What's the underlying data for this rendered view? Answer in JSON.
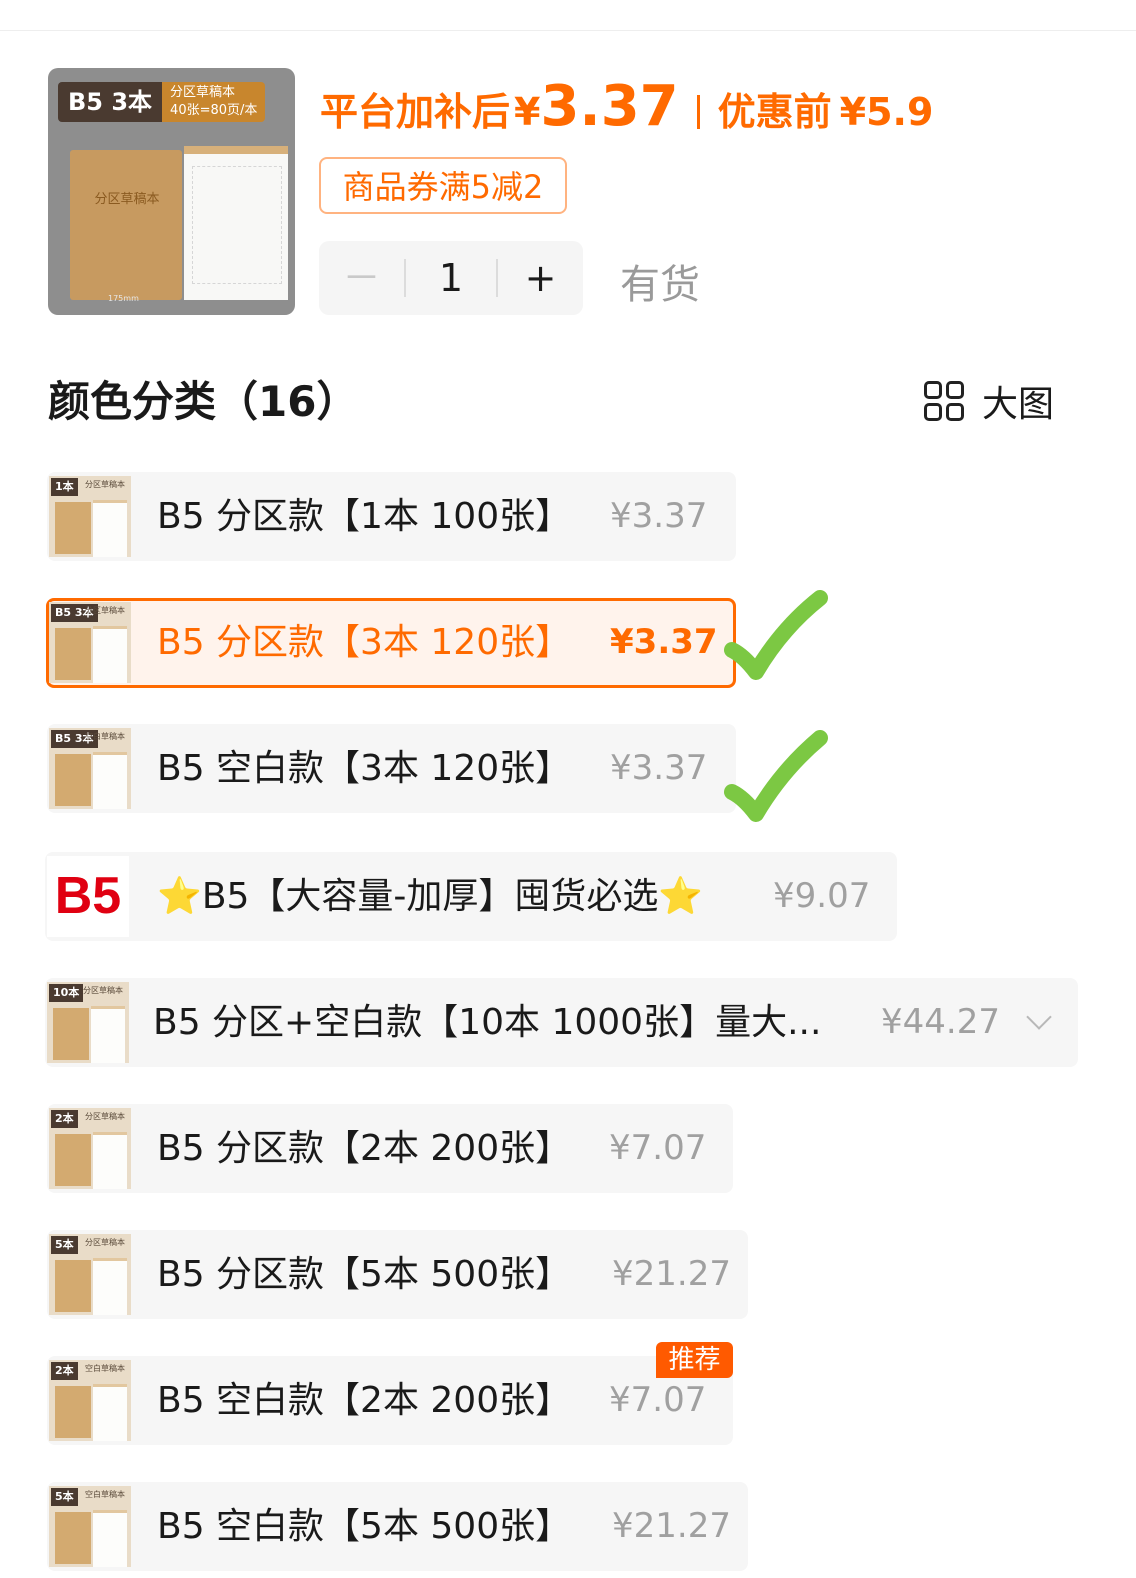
{
  "product": {
    "thumb_tag_main": "B5 3本",
    "thumb_tag_sub1": "分区草稿本",
    "thumb_tag_sub2": "40张=80页/本",
    "thumb_book_title": "分区草稿本",
    "thumb_dim": "175mm",
    "price_label": "平台加补后",
    "currency": "¥",
    "price_value": "3.37",
    "original_label": "优惠前",
    "original_price": "¥5.9",
    "coupon": "商品券满5减2",
    "quantity": "1",
    "minus": "－",
    "plus": "+",
    "stock": "有货"
  },
  "section": {
    "title": "颜色分类（16）",
    "view_label": "大图"
  },
  "options": [
    {
      "name": "B5 分区款【1本 100张】",
      "price": "¥3.37",
      "thumb_tag": "1本",
      "thumb_sub": "分区草稿本"
    },
    {
      "name": "B5 分区款【3本 120张】",
      "price": "¥3.37",
      "thumb_tag": "B5 3本",
      "thumb_sub": "分区草稿本",
      "selected": true
    },
    {
      "name": "B5 空白款【3本 120张】",
      "price": "¥3.37",
      "thumb_tag": "B5 3本",
      "thumb_sub": "空白草稿本"
    },
    {
      "name_prefix": "⭐",
      "name": "B5【大容量-加厚】囤货必选",
      "name_suffix": "⭐",
      "price": "¥9.07",
      "thumb_text": "B5"
    },
    {
      "name": "B5 分区+空白款【10本 1000张】量大...",
      "price": "¥44.27",
      "thumb_tag": "10本",
      "thumb_sub": "分区草稿本"
    },
    {
      "name": "B5 分区款【2本 200张】",
      "price": "¥7.07",
      "thumb_tag": "2本",
      "thumb_sub": "分区草稿本"
    },
    {
      "name": "B5 分区款【5本 500张】",
      "price": "¥21.27",
      "thumb_tag": "5本",
      "thumb_sub": "分区草稿本"
    },
    {
      "name": "B5 空白款【2本 200张】",
      "price": "¥7.07",
      "thumb_tag": "2本",
      "thumb_sub": "空白草稿本",
      "badge": "推荐"
    },
    {
      "name": "B5 空白款【5本 500张】",
      "price": "¥21.27",
      "thumb_tag": "5本",
      "thumb_sub": "空白草稿本"
    }
  ],
  "colors": {
    "accent": "#ff6a00",
    "selected_bg": "#fff3ec",
    "option_bg": "#f6f6f6",
    "price_gray": "#a0a0a0",
    "check_green": "#7cc843",
    "b5_red": "#e00011"
  }
}
